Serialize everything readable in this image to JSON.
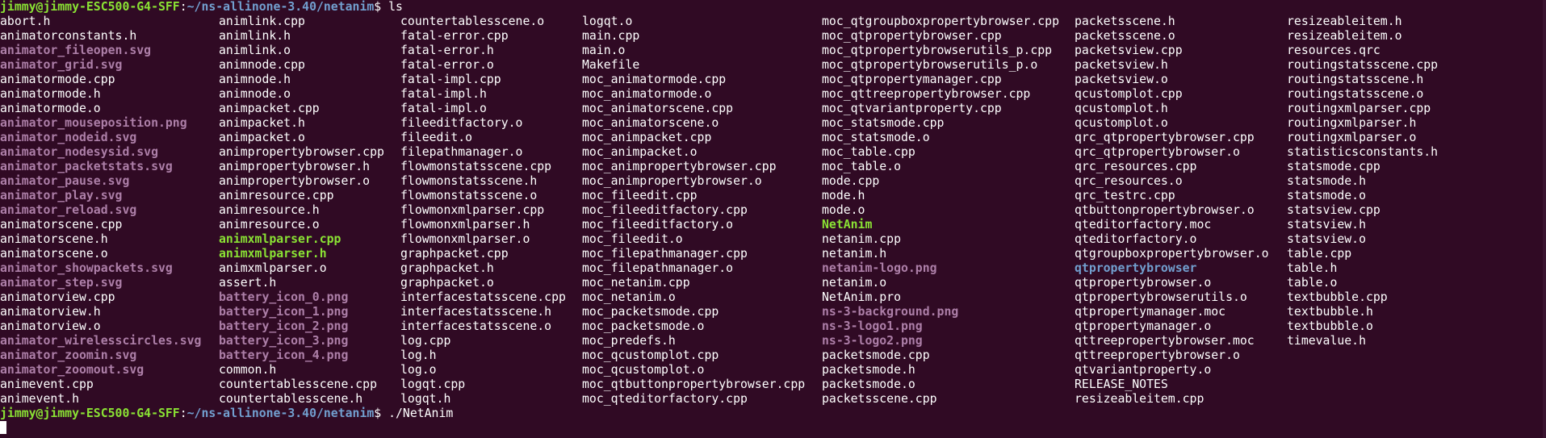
{
  "terminal": {
    "colors": {
      "background": "#300a24",
      "foreground": "#ffffff",
      "prompt_user": "#8ae234",
      "prompt_path": "#729fcf",
      "image_file": "#ad7fa8",
      "executable": "#8ae234",
      "directory": "#729fcf"
    },
    "prompt1": {
      "user_host": "jimmy@jimmy-ESC500-G4-SFF",
      "colon": ":",
      "path": "~/ns-allinone-3.40/netanim",
      "symbol": "$ ",
      "command": "ls"
    },
    "columns": [
      [
        {
          "name": "abort.h",
          "type": "file"
        },
        {
          "name": "animatorconstants.h",
          "type": "file"
        },
        {
          "name": "animator_fileopen.svg",
          "type": "image"
        },
        {
          "name": "animator_grid.svg",
          "type": "image"
        },
        {
          "name": "animatormode.cpp",
          "type": "file"
        },
        {
          "name": "animatormode.h",
          "type": "file"
        },
        {
          "name": "animatormode.o",
          "type": "file"
        },
        {
          "name": "animator_mouseposition.png",
          "type": "image"
        },
        {
          "name": "animator_nodeid.svg",
          "type": "image"
        },
        {
          "name": "animator_nodesysid.svg",
          "type": "image"
        },
        {
          "name": "animator_packetstats.svg",
          "type": "image"
        },
        {
          "name": "animator_pause.svg",
          "type": "image"
        },
        {
          "name": "animator_play.svg",
          "type": "image"
        },
        {
          "name": "animator_reload.svg",
          "type": "image"
        },
        {
          "name": "animatorscene.cpp",
          "type": "file"
        },
        {
          "name": "animatorscene.h",
          "type": "file"
        },
        {
          "name": "animatorscene.o",
          "type": "file"
        },
        {
          "name": "animator_showpackets.svg",
          "type": "image"
        },
        {
          "name": "animator_step.svg",
          "type": "image"
        },
        {
          "name": "animatorview.cpp",
          "type": "file"
        },
        {
          "name": "animatorview.h",
          "type": "file"
        },
        {
          "name": "animatorview.o",
          "type": "file"
        },
        {
          "name": "animator_wirelesscircles.svg",
          "type": "image"
        },
        {
          "name": "animator_zoomin.svg",
          "type": "image"
        },
        {
          "name": "animator_zoomout.svg",
          "type": "image"
        },
        {
          "name": "animevent.cpp",
          "type": "file"
        },
        {
          "name": "animevent.h",
          "type": "file"
        }
      ],
      [
        {
          "name": "animlink.cpp",
          "type": "file"
        },
        {
          "name": "animlink.h",
          "type": "file"
        },
        {
          "name": "animlink.o",
          "type": "file"
        },
        {
          "name": "animnode.cpp",
          "type": "file"
        },
        {
          "name": "animnode.h",
          "type": "file"
        },
        {
          "name": "animnode.o",
          "type": "file"
        },
        {
          "name": "animpacket.cpp",
          "type": "file"
        },
        {
          "name": "animpacket.h",
          "type": "file"
        },
        {
          "name": "animpacket.o",
          "type": "file"
        },
        {
          "name": "animpropertybrowser.cpp",
          "type": "file"
        },
        {
          "name": "animpropertybrowser.h",
          "type": "file"
        },
        {
          "name": "animpropertybrowser.o",
          "type": "file"
        },
        {
          "name": "animresource.cpp",
          "type": "file"
        },
        {
          "name": "animresource.h",
          "type": "file"
        },
        {
          "name": "animresource.o",
          "type": "file"
        },
        {
          "name": "animxmlparser.cpp",
          "type": "exec"
        },
        {
          "name": "animxmlparser.h",
          "type": "exec"
        },
        {
          "name": "animxmlparser.o",
          "type": "file"
        },
        {
          "name": "assert.h",
          "type": "file"
        },
        {
          "name": "battery_icon_0.png",
          "type": "image"
        },
        {
          "name": "battery_icon_1.png",
          "type": "image"
        },
        {
          "name": "battery_icon_2.png",
          "type": "image"
        },
        {
          "name": "battery_icon_3.png",
          "type": "image"
        },
        {
          "name": "battery_icon_4.png",
          "type": "image"
        },
        {
          "name": "common.h",
          "type": "file"
        },
        {
          "name": "countertablesscene.cpp",
          "type": "file"
        },
        {
          "name": "countertablesscene.h",
          "type": "file"
        }
      ],
      [
        {
          "name": "countertablesscene.o",
          "type": "file"
        },
        {
          "name": "fatal-error.cpp",
          "type": "file"
        },
        {
          "name": "fatal-error.h",
          "type": "file"
        },
        {
          "name": "fatal-error.o",
          "type": "file"
        },
        {
          "name": "fatal-impl.cpp",
          "type": "file"
        },
        {
          "name": "fatal-impl.h",
          "type": "file"
        },
        {
          "name": "fatal-impl.o",
          "type": "file"
        },
        {
          "name": "fileeditfactory.o",
          "type": "file"
        },
        {
          "name": "fileedit.o",
          "type": "file"
        },
        {
          "name": "filepathmanager.o",
          "type": "file"
        },
        {
          "name": "flowmonstatsscene.cpp",
          "type": "file"
        },
        {
          "name": "flowmonstatsscene.h",
          "type": "file"
        },
        {
          "name": "flowmonstatsscene.o",
          "type": "file"
        },
        {
          "name": "flowmonxmlparser.cpp",
          "type": "file"
        },
        {
          "name": "flowmonxmlparser.h",
          "type": "file"
        },
        {
          "name": "flowmonxmlparser.o",
          "type": "file"
        },
        {
          "name": "graphpacket.cpp",
          "type": "file"
        },
        {
          "name": "graphpacket.h",
          "type": "file"
        },
        {
          "name": "graphpacket.o",
          "type": "file"
        },
        {
          "name": "interfacestatsscene.cpp",
          "type": "file"
        },
        {
          "name": "interfacestatsscene.h",
          "type": "file"
        },
        {
          "name": "interfacestatsscene.o",
          "type": "file"
        },
        {
          "name": "log.cpp",
          "type": "file"
        },
        {
          "name": "log.h",
          "type": "file"
        },
        {
          "name": "log.o",
          "type": "file"
        },
        {
          "name": "logqt.cpp",
          "type": "file"
        },
        {
          "name": "logqt.h",
          "type": "file"
        }
      ],
      [
        {
          "name": "logqt.o",
          "type": "file"
        },
        {
          "name": "main.cpp",
          "type": "file"
        },
        {
          "name": "main.o",
          "type": "file"
        },
        {
          "name": "Makefile",
          "type": "file"
        },
        {
          "name": "moc_animatormode.cpp",
          "type": "file"
        },
        {
          "name": "moc_animatormode.o",
          "type": "file"
        },
        {
          "name": "moc_animatorscene.cpp",
          "type": "file"
        },
        {
          "name": "moc_animatorscene.o",
          "type": "file"
        },
        {
          "name": "moc_animpacket.cpp",
          "type": "file"
        },
        {
          "name": "moc_animpacket.o",
          "type": "file"
        },
        {
          "name": "moc_animpropertybrowser.cpp",
          "type": "file"
        },
        {
          "name": "moc_animpropertybrowser.o",
          "type": "file"
        },
        {
          "name": "moc_fileedit.cpp",
          "type": "file"
        },
        {
          "name": "moc_fileeditfactory.cpp",
          "type": "file"
        },
        {
          "name": "moc_fileeditfactory.o",
          "type": "file"
        },
        {
          "name": "moc_fileedit.o",
          "type": "file"
        },
        {
          "name": "moc_filepathmanager.cpp",
          "type": "file"
        },
        {
          "name": "moc_filepathmanager.o",
          "type": "file"
        },
        {
          "name": "moc_netanim.cpp",
          "type": "file"
        },
        {
          "name": "moc_netanim.o",
          "type": "file"
        },
        {
          "name": "moc_packetsmode.cpp",
          "type": "file"
        },
        {
          "name": "moc_packetsmode.o",
          "type": "file"
        },
        {
          "name": "moc_predefs.h",
          "type": "file"
        },
        {
          "name": "moc_qcustomplot.cpp",
          "type": "file"
        },
        {
          "name": "moc_qcustomplot.o",
          "type": "file"
        },
        {
          "name": "moc_qtbuttonpropertybrowser.cpp",
          "type": "file"
        },
        {
          "name": "moc_qteditorfactory.cpp",
          "type": "file"
        }
      ],
      [
        {
          "name": "moc_qtgroupboxpropertybrowser.cpp",
          "type": "file"
        },
        {
          "name": "moc_qtpropertybrowser.cpp",
          "type": "file"
        },
        {
          "name": "moc_qtpropertybrowserutils_p.cpp",
          "type": "file"
        },
        {
          "name": "moc_qtpropertybrowserutils_p.o",
          "type": "file"
        },
        {
          "name": "moc_qtpropertymanager.cpp",
          "type": "file"
        },
        {
          "name": "moc_qttreepropertybrowser.cpp",
          "type": "file"
        },
        {
          "name": "moc_qtvariantproperty.cpp",
          "type": "file"
        },
        {
          "name": "moc_statsmode.cpp",
          "type": "file"
        },
        {
          "name": "moc_statsmode.o",
          "type": "file"
        },
        {
          "name": "moc_table.cpp",
          "type": "file"
        },
        {
          "name": "moc_table.o",
          "type": "file"
        },
        {
          "name": "mode.cpp",
          "type": "file"
        },
        {
          "name": "mode.h",
          "type": "file"
        },
        {
          "name": "mode.o",
          "type": "file"
        },
        {
          "name": "NetAnim",
          "type": "exec"
        },
        {
          "name": "netanim.cpp",
          "type": "file"
        },
        {
          "name": "netanim.h",
          "type": "file"
        },
        {
          "name": "netanim-logo.png",
          "type": "image"
        },
        {
          "name": "netanim.o",
          "type": "file"
        },
        {
          "name": "NetAnim.pro",
          "type": "file"
        },
        {
          "name": "ns-3-background.png",
          "type": "image"
        },
        {
          "name": "ns-3-logo1.png",
          "type": "image"
        },
        {
          "name": "ns-3-logo2.png",
          "type": "image"
        },
        {
          "name": "packetsmode.cpp",
          "type": "file"
        },
        {
          "name": "packetsmode.h",
          "type": "file"
        },
        {
          "name": "packetsmode.o",
          "type": "file"
        },
        {
          "name": "packetsscene.cpp",
          "type": "file"
        }
      ],
      [
        {
          "name": "packetsscene.h",
          "type": "file"
        },
        {
          "name": "packetsscene.o",
          "type": "file"
        },
        {
          "name": "packetsview.cpp",
          "type": "file"
        },
        {
          "name": "packetsview.h",
          "type": "file"
        },
        {
          "name": "packetsview.o",
          "type": "file"
        },
        {
          "name": "qcustomplot.cpp",
          "type": "file"
        },
        {
          "name": "qcustomplot.h",
          "type": "file"
        },
        {
          "name": "qcustomplot.o",
          "type": "file"
        },
        {
          "name": "qrc_qtpropertybrowser.cpp",
          "type": "file"
        },
        {
          "name": "qrc_qtpropertybrowser.o",
          "type": "file"
        },
        {
          "name": "qrc_resources.cpp",
          "type": "file"
        },
        {
          "name": "qrc_resources.o",
          "type": "file"
        },
        {
          "name": "qrc_testrc.cpp",
          "type": "file"
        },
        {
          "name": "qtbuttonpropertybrowser.o",
          "type": "file"
        },
        {
          "name": "qteditorfactory.moc",
          "type": "file"
        },
        {
          "name": "qteditorfactory.o",
          "type": "file"
        },
        {
          "name": "qtgroupboxpropertybrowser.o",
          "type": "file"
        },
        {
          "name": "qtpropertybrowser",
          "type": "dir"
        },
        {
          "name": "qtpropertybrowser.o",
          "type": "file"
        },
        {
          "name": "qtpropertybrowserutils.o",
          "type": "file"
        },
        {
          "name": "qtpropertymanager.moc",
          "type": "file"
        },
        {
          "name": "qtpropertymanager.o",
          "type": "file"
        },
        {
          "name": "qttreepropertybrowser.moc",
          "type": "file"
        },
        {
          "name": "qttreepropertybrowser.o",
          "type": "file"
        },
        {
          "name": "qtvariantproperty.o",
          "type": "file"
        },
        {
          "name": "RELEASE_NOTES",
          "type": "file"
        },
        {
          "name": "resizeableitem.cpp",
          "type": "file"
        }
      ],
      [
        {
          "name": "resizeableitem.h",
          "type": "file"
        },
        {
          "name": "resizeableitem.o",
          "type": "file"
        },
        {
          "name": "resources.qrc",
          "type": "file"
        },
        {
          "name": "routingstatsscene.cpp",
          "type": "file"
        },
        {
          "name": "routingstatsscene.h",
          "type": "file"
        },
        {
          "name": "routingstatsscene.o",
          "type": "file"
        },
        {
          "name": "routingxmlparser.cpp",
          "type": "file"
        },
        {
          "name": "routingxmlparser.h",
          "type": "file"
        },
        {
          "name": "routingxmlparser.o",
          "type": "file"
        },
        {
          "name": "statisticsconstants.h",
          "type": "file"
        },
        {
          "name": "statsmode.cpp",
          "type": "file"
        },
        {
          "name": "statsmode.h",
          "type": "file"
        },
        {
          "name": "statsmode.o",
          "type": "file"
        },
        {
          "name": "statsview.cpp",
          "type": "file"
        },
        {
          "name": "statsview.h",
          "type": "file"
        },
        {
          "name": "statsview.o",
          "type": "file"
        },
        {
          "name": "table.cpp",
          "type": "file"
        },
        {
          "name": "table.h",
          "type": "file"
        },
        {
          "name": "table.o",
          "type": "file"
        },
        {
          "name": "textbubble.cpp",
          "type": "file"
        },
        {
          "name": "textbubble.h",
          "type": "file"
        },
        {
          "name": "textbubble.o",
          "type": "file"
        },
        {
          "name": "timevalue.h",
          "type": "file"
        }
      ]
    ],
    "prompt2": {
      "user_host": "jimmy@jimmy-ESC500-G4-SFF",
      "colon": ":",
      "path": "~/ns-allinone-3.40/netanim",
      "symbol": "$ ",
      "command": "./NetAnim"
    }
  }
}
